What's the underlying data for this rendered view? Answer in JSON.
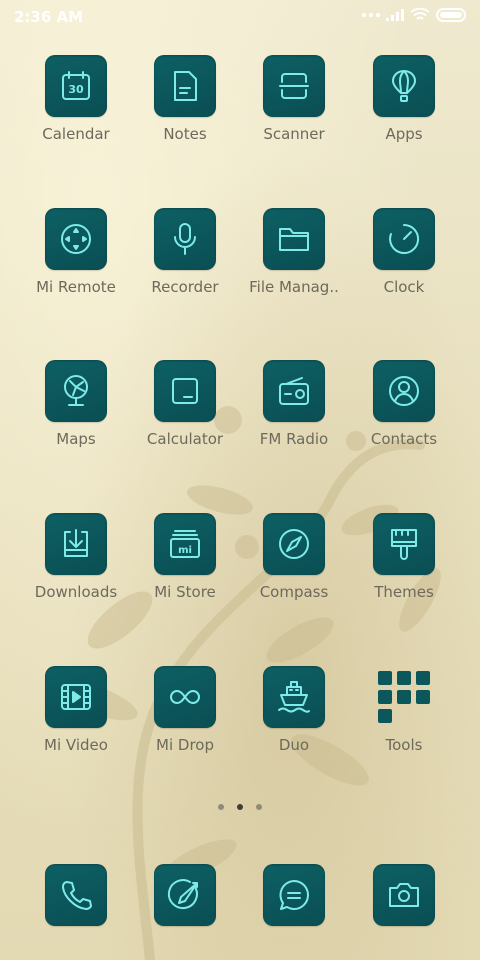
{
  "status_bar": {
    "time": "2:36 AM"
  },
  "rows": [
    [
      {
        "label": "Calendar",
        "icon": "calendar-icon",
        "day": "30"
      },
      {
        "label": "Notes",
        "icon": "notes-icon"
      },
      {
        "label": "Scanner",
        "icon": "scanner-icon"
      },
      {
        "label": "Apps",
        "icon": "balloon-icon"
      }
    ],
    [
      {
        "label": "Mi Remote",
        "icon": "remote-icon"
      },
      {
        "label": "Recorder",
        "icon": "microphone-icon"
      },
      {
        "label": "File Manag..",
        "icon": "folder-icon"
      },
      {
        "label": "Clock",
        "icon": "clock-icon"
      }
    ],
    [
      {
        "label": "Maps",
        "icon": "fan-icon"
      },
      {
        "label": "Calculator",
        "icon": "calculator-icon"
      },
      {
        "label": "FM Radio",
        "icon": "radio-icon"
      },
      {
        "label": "Contacts",
        "icon": "contacts-icon"
      }
    ],
    [
      {
        "label": "Downloads",
        "icon": "download-icon"
      },
      {
        "label": "Mi Store",
        "icon": "mi-store-icon",
        "brand": "mi"
      },
      {
        "label": "Compass",
        "icon": "compass-icon"
      },
      {
        "label": "Themes",
        "icon": "paintbrush-icon"
      }
    ],
    [
      {
        "label": "Mi Video",
        "icon": "film-icon"
      },
      {
        "label": "Mi Drop",
        "icon": "infinity-icon"
      },
      {
        "label": "Duo",
        "icon": "ship-icon"
      },
      {
        "label": "Tools",
        "icon": "tools-folder-icon"
      }
    ]
  ],
  "pager": {
    "pages": 3,
    "active": 2
  },
  "dock": [
    {
      "icon": "phone-icon"
    },
    {
      "icon": "browser-icon"
    },
    {
      "icon": "message-icon"
    },
    {
      "icon": "camera-icon"
    }
  ],
  "colors": {
    "tile": "#0b575b",
    "glyph": "#7cebea",
    "label": "#6d6a5c"
  }
}
